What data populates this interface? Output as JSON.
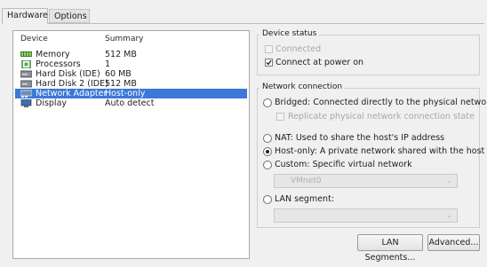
{
  "tabs": {
    "hardware": "Hardware",
    "options": "Options"
  },
  "device_list": {
    "col_device": "Device",
    "col_summary": "Summary",
    "rows": [
      {
        "device": "Memory",
        "summary": "512 MB",
        "icon": "memory-icon"
      },
      {
        "device": "Processors",
        "summary": "1",
        "icon": "processor-icon"
      },
      {
        "device": "Hard Disk (IDE)",
        "summary": "60 MB",
        "icon": "hard-disk-icon"
      },
      {
        "device": "Hard Disk 2 (IDE)",
        "summary": "512 MB",
        "icon": "hard-disk-icon"
      },
      {
        "device": "Network Adapter",
        "summary": "Host-only",
        "icon": "network-adapter-icon",
        "selected": true
      },
      {
        "device": "Display",
        "summary": "Auto detect",
        "icon": "display-icon"
      }
    ]
  },
  "device_status": {
    "title": "Device status",
    "connected": "Connected",
    "connected_checked": false,
    "connect_at_power_on": "Connect at power on",
    "connect_at_power_on_checked": true
  },
  "network_connection": {
    "title": "Network connection",
    "bridged": "Bridged: Connected directly to the physical network",
    "replicate": "Replicate physical network connection state",
    "nat": "NAT: Used to share the host's IP address",
    "host_only": "Host-only: A private network shared with the host",
    "custom": "Custom: Specific virtual network",
    "custom_combo_value": "VMnet0",
    "lan_segment": "LAN segment:",
    "lan_combo_value": "",
    "selected": "host_only"
  },
  "buttons": {
    "lan_segments": "LAN Segments...",
    "advanced": "Advanced..."
  },
  "colors": {
    "selection": "#3c78d8",
    "background": "#f0f0f0"
  }
}
